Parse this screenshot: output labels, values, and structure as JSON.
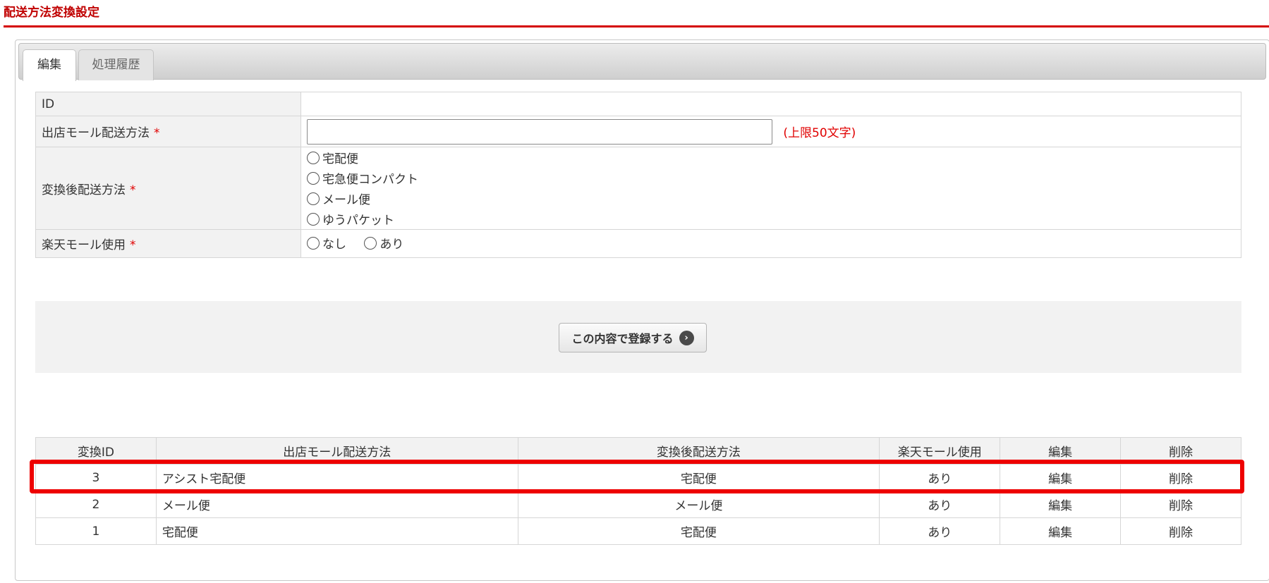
{
  "page": {
    "title": "配送方法変換設定"
  },
  "tabs": [
    {
      "label": "編集",
      "active": true
    },
    {
      "label": "処理履歴",
      "active": false
    }
  ],
  "form": {
    "id_label": "ID",
    "id_value": "",
    "shop_method_label": "出店モール配送方法",
    "shop_method_value": "",
    "shop_method_limit": "(上限50文字)",
    "converted_label": "変換後配送方法",
    "converted_options": [
      "宅配便",
      "宅急便コンパクト",
      "メール便",
      "ゆうパケット"
    ],
    "rakuten_label": "楽天モール使用",
    "rakuten_options": [
      "なし",
      "あり"
    ],
    "required_mark": "*"
  },
  "submit": {
    "label": "この内容で登録する",
    "icon": "arrow-right-circle-icon"
  },
  "list": {
    "headers": [
      "変換ID",
      "出店モール配送方法",
      "変換後配送方法",
      "楽天モール使用",
      "編集",
      "削除"
    ],
    "rows": [
      {
        "id": "3",
        "shop_method": "アシスト宅配便",
        "converted": "宅配便",
        "rakuten": "あり",
        "edit": "編集",
        "delete": "削除"
      },
      {
        "id": "2",
        "shop_method": "メール便",
        "converted": "メール便",
        "rakuten": "あり",
        "edit": "編集",
        "delete": "削除"
      },
      {
        "id": "1",
        "shop_method": "宅配便",
        "converted": "宅配便",
        "rakuten": "あり",
        "edit": "編集",
        "delete": "削除"
      }
    ],
    "highlighted_row_index": 0
  },
  "colors": {
    "title": "#c00000",
    "rule": "#d40000",
    "required": "#e00000",
    "highlight": "#ee0000"
  }
}
